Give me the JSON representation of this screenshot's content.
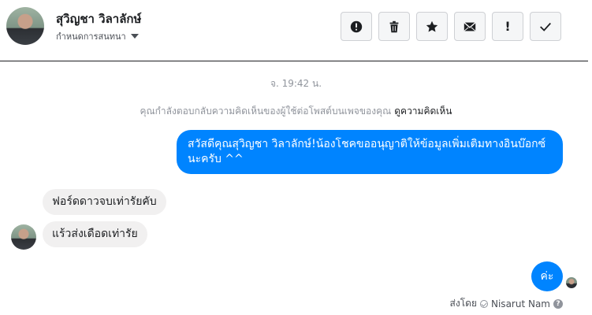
{
  "header": {
    "contact_name": "สุวิญชา วิลาลักษ์",
    "assign_label": "กำหนดการสนทนา",
    "tools": [
      {
        "name": "mark-spam-button",
        "icon": "alert-circle-icon"
      },
      {
        "name": "delete-button",
        "icon": "trash-icon"
      },
      {
        "name": "star-button",
        "icon": "star-icon"
      },
      {
        "name": "mark-unread-button",
        "icon": "envelope-icon"
      },
      {
        "name": "follow-up-button",
        "label": "!"
      },
      {
        "name": "mark-done-button",
        "icon": "check-icon"
      }
    ]
  },
  "conversation": {
    "timestamp": "จ. 19:42 น.",
    "notice_text": "คุณกำลังตอบกลับความคิดเห็นของผู้ใช้ต่อโพสต์บนเพจของคุณ",
    "notice_link": "ดูความคิดเห็น",
    "messages": [
      {
        "direction": "out",
        "text": "สวัสดีคุณสุวิญชา วิลาลักษ์!น้องโชคขออนุญาติให้ข้อมูลเพิ่มเติมทางอินบ๊อกซ์นะครับ ^^"
      },
      {
        "direction": "in",
        "text": "ฟอร์ดดาวจบเท่ารัยคับ"
      },
      {
        "direction": "in",
        "text": "แร้วส่งเดือดเท่ารัย"
      },
      {
        "direction": "out",
        "text": "ค่ะ"
      }
    ],
    "sent_by_label": "ส่งโดย",
    "sent_by_name": "Nisarut Nam",
    "help_glyph": "?"
  },
  "colors": {
    "outgoing_bubble": "#0084ff",
    "incoming_bubble": "#f1f0f0"
  }
}
